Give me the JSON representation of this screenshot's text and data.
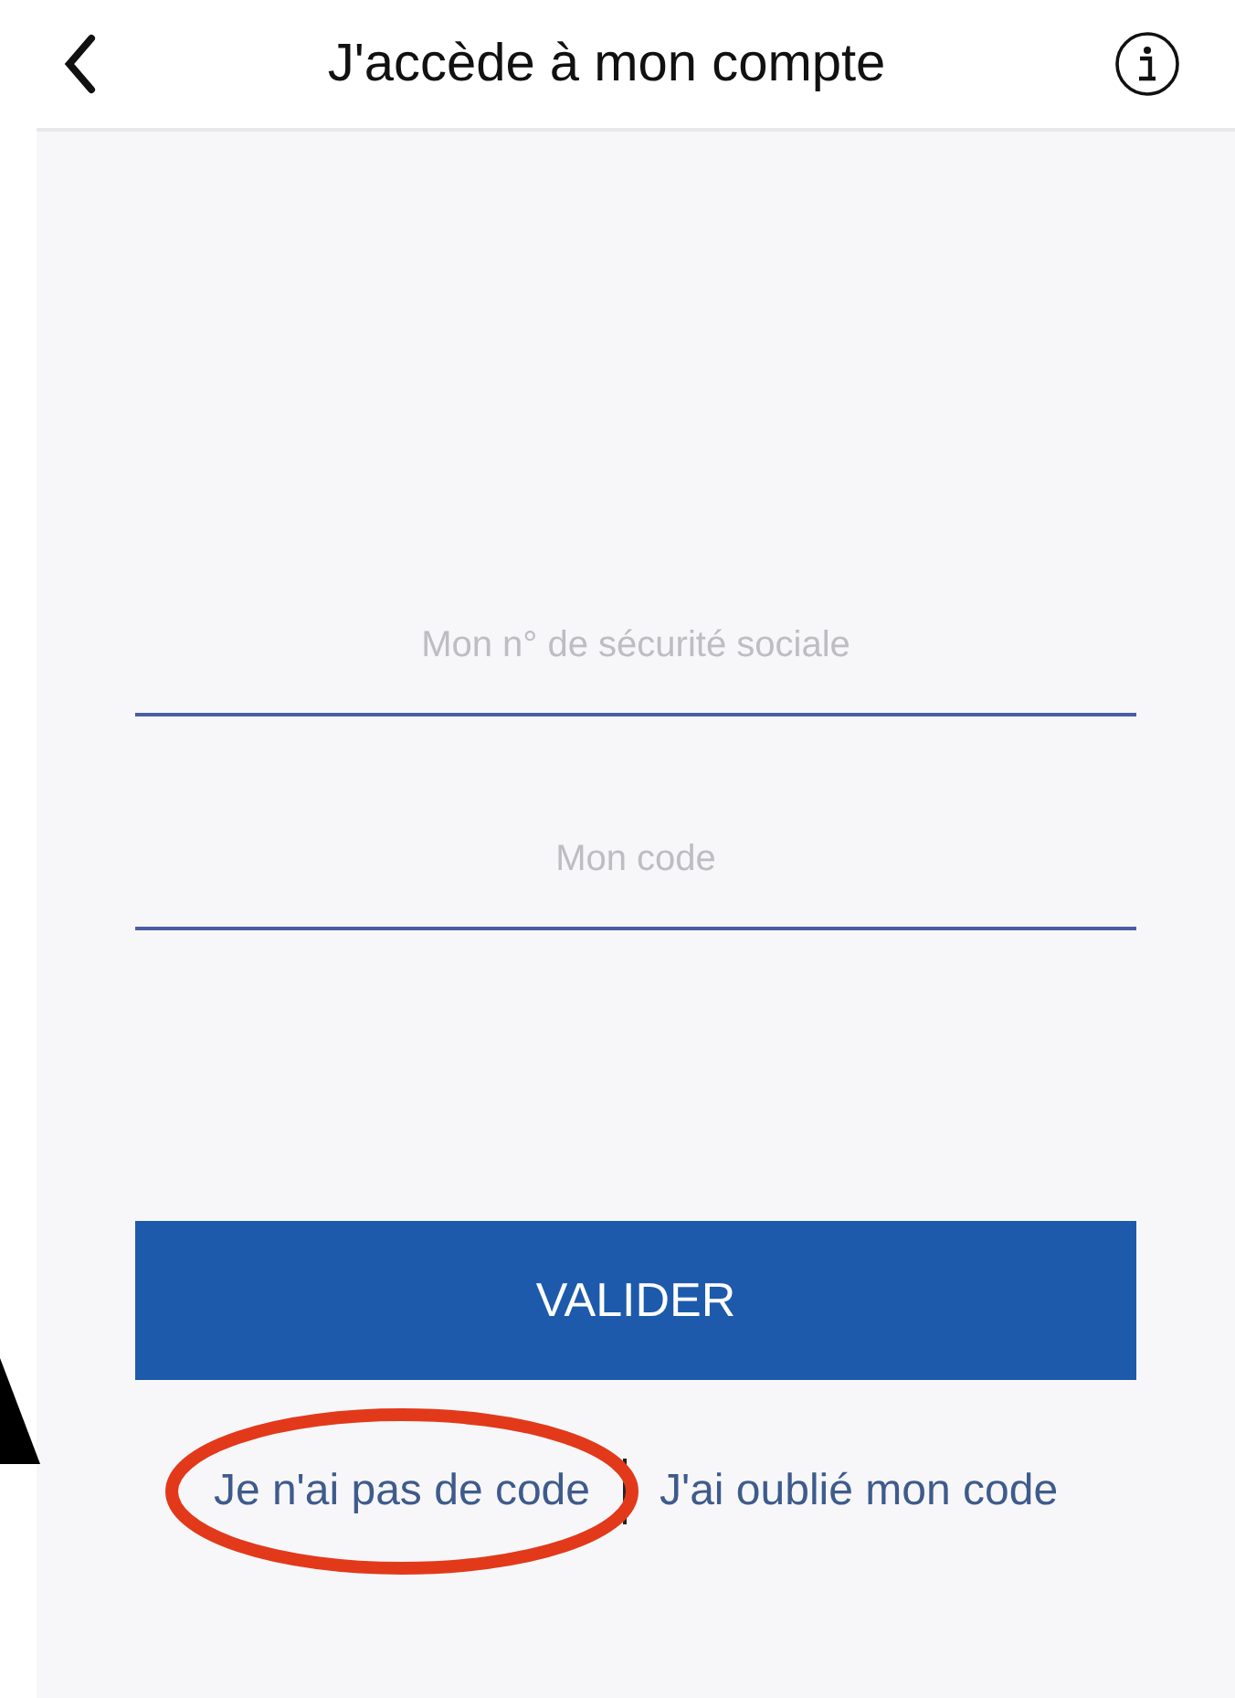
{
  "header": {
    "title": "J'accède à mon compte"
  },
  "fields": [
    {
      "placeholder": "Mon n° de sécurité sociale"
    },
    {
      "placeholder": "Mon code"
    }
  ],
  "submit": {
    "label": "VALIDER"
  },
  "links": [
    {
      "label": "Je n'ai pas de code",
      "circled": true
    },
    {
      "label": "J'ai oublié mon code",
      "circled": false
    }
  ]
}
